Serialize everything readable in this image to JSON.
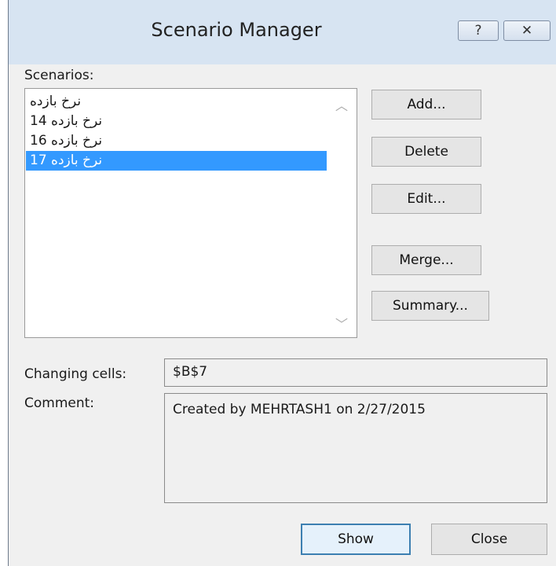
{
  "dialog": {
    "title": "Scenario Manager",
    "help_glyph": "?",
    "close_glyph": "✕"
  },
  "scenarios": {
    "label": "Scenarios:",
    "items": [
      {
        "label": "نرخ بازده",
        "selected": false
      },
      {
        "label": "نرخ بازده 14",
        "selected": false
      },
      {
        "label": "نرخ بازده 16",
        "selected": false
      },
      {
        "label": "نرخ بازده 17",
        "selected": true
      }
    ],
    "scroll_up_glyph": "︿",
    "scroll_down_glyph": "﹀"
  },
  "buttons": {
    "add": "Add...",
    "delete": "Delete",
    "edit": "Edit...",
    "merge": "Merge...",
    "summary": "Summary...",
    "show": "Show",
    "close": "Close"
  },
  "changing_cells": {
    "label": "Changing cells:",
    "value": "$B$7"
  },
  "comment": {
    "label": "Comment:",
    "value": "Created by MEHRTASH1 on 2/27/2015"
  },
  "colors": {
    "selection": "#3399ff",
    "titlebar": "#d7e4f2",
    "dialog_bg": "#f0f0f0"
  }
}
